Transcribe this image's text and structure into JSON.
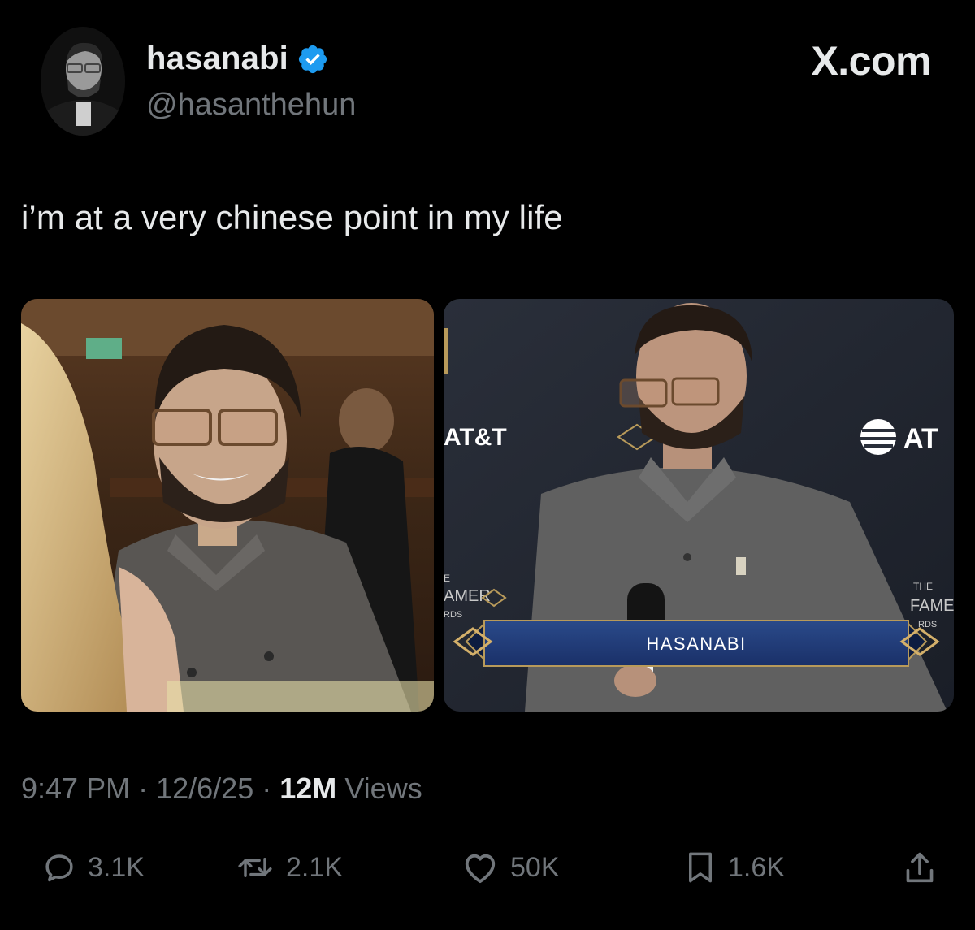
{
  "header": {
    "display_name": "hasanabi",
    "handle": "@hasanthehun",
    "brand": "X.com",
    "verified": true
  },
  "tweet": {
    "text": "i’m at a very chinese point in my life"
  },
  "media": {
    "right_image": {
      "sponsor_left": "AT&T",
      "sponsor_right": "AT",
      "banner_name": "HASANABI",
      "logo_left_lines": [
        "E",
        "AMER",
        "RDS"
      ],
      "logo_right_lines": [
        "THE",
        "FAME",
        "RDS"
      ]
    }
  },
  "meta": {
    "time": "9:47 PM",
    "date": "12/6/25",
    "separator": "·",
    "views_count": "12M",
    "views_label": "Views"
  },
  "actions": {
    "replies": "3.1K",
    "reposts": "2.1K",
    "likes": "50K",
    "bookmarks": "1.6K"
  },
  "colors": {
    "background": "#000000",
    "text_primary": "#e7e9ea",
    "text_secondary": "#71767b",
    "verified_blue": "#1d9bf0"
  }
}
